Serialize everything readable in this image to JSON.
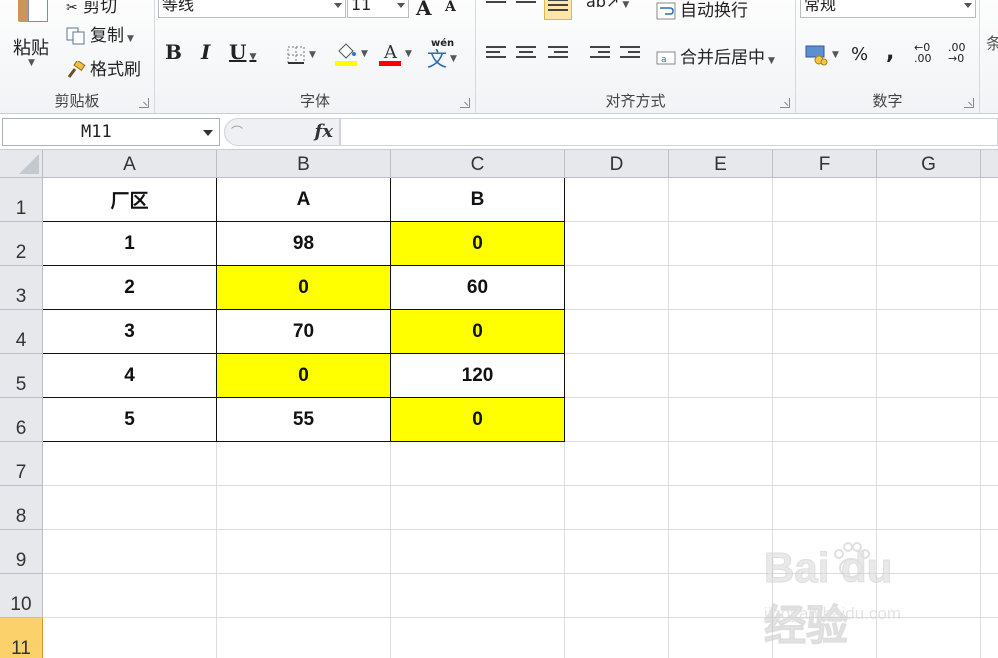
{
  "ribbon": {
    "clipboard": {
      "paste_label": "粘贴",
      "cut_label": "剪切",
      "copy_label": "复制",
      "format_painter_label": "格式刷",
      "group_label": "剪贴板"
    },
    "font": {
      "font_name": "等线",
      "font_size": "11",
      "grow_font": "A",
      "shrink_font": "A",
      "bold": "B",
      "italic": "I",
      "underline": "U",
      "phonetic": "wén",
      "phonetic_char": "文",
      "group_label": "字体",
      "fill_color": "#ffff00",
      "font_color": "#ff0000"
    },
    "alignment": {
      "wrap_text_label": "自动换行",
      "merge_center_label": "合并后居中",
      "group_label": "对齐方式"
    },
    "number": {
      "format_value": "常规",
      "percent": "%",
      "comma": ",",
      "group_label": "数字"
    }
  },
  "formula_bar": {
    "name_box": "M11",
    "fx_label": "fx",
    "formula": ""
  },
  "sheet": {
    "columns": [
      "A",
      "B",
      "C",
      "D",
      "E",
      "F",
      "G"
    ],
    "rows": [
      "1",
      "2",
      "3",
      "4",
      "5",
      "6",
      "7",
      "8",
      "9",
      "10",
      "11"
    ],
    "active_row": "11",
    "highlight_color": "#ffff00",
    "table": [
      [
        {
          "v": "厂区",
          "y": false
        },
        {
          "v": "A",
          "y": false
        },
        {
          "v": "B",
          "y": false
        }
      ],
      [
        {
          "v": "1",
          "y": false
        },
        {
          "v": "98",
          "y": false
        },
        {
          "v": "0",
          "y": true
        }
      ],
      [
        {
          "v": "2",
          "y": false
        },
        {
          "v": "0",
          "y": true
        },
        {
          "v": "60",
          "y": false
        }
      ],
      [
        {
          "v": "3",
          "y": false
        },
        {
          "v": "70",
          "y": false
        },
        {
          "v": "0",
          "y": true
        }
      ],
      [
        {
          "v": "4",
          "y": false
        },
        {
          "v": "0",
          "y": true
        },
        {
          "v": "120",
          "y": false
        }
      ],
      [
        {
          "v": "5",
          "y": false
        },
        {
          "v": "55",
          "y": false
        },
        {
          "v": "0",
          "y": true
        }
      ]
    ]
  },
  "watermark": {
    "logo_text": "Bai du 经验",
    "url": "jingyan.baidu.com"
  }
}
